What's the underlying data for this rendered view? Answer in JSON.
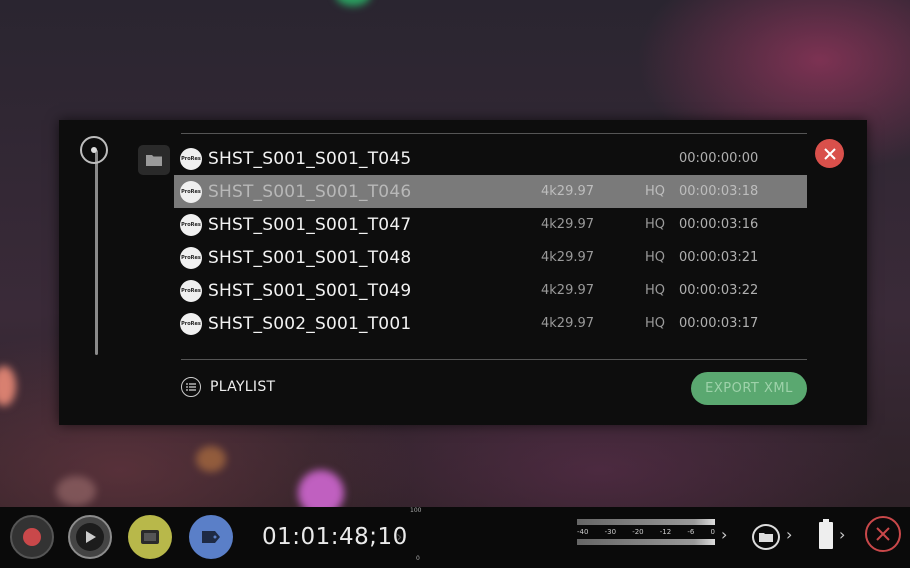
{
  "dialog": {
    "clips": [
      {
        "name": "SHST_S001_S001_T045",
        "resolution": "",
        "codec": "",
        "timecode": "00:00:00:00",
        "selected": false,
        "badge": "ProRes"
      },
      {
        "name": "SHST_S001_S001_T046",
        "resolution": "4k29.97",
        "codec": "HQ",
        "timecode": "00:00:03:18",
        "selected": true,
        "badge": "ProRes"
      },
      {
        "name": "SHST_S001_S001_T047",
        "resolution": "4k29.97",
        "codec": "HQ",
        "timecode": "00:00:03:16",
        "selected": false,
        "badge": "ProRes"
      },
      {
        "name": "SHST_S001_S001_T048",
        "resolution": "4k29.97",
        "codec": "HQ",
        "timecode": "00:00:03:21",
        "selected": false,
        "badge": "ProRes"
      },
      {
        "name": "SHST_S001_S001_T049",
        "resolution": "4k29.97",
        "codec": "HQ",
        "timecode": "00:00:03:22",
        "selected": false,
        "badge": "ProRes"
      },
      {
        "name": "SHST_S002_S001_T001",
        "resolution": "4k29.97",
        "codec": "HQ",
        "timecode": "00:00:03:17",
        "selected": false,
        "badge": "ProRes"
      }
    ],
    "playlist_label": "PLAYLIST",
    "export_label": "EXPORT XML"
  },
  "bottombar": {
    "timecode": "01:01:48;10",
    "vu_top": "100",
    "vu_bottom": "0",
    "meter_scale": [
      "-40",
      "-30",
      "-20",
      "-12",
      "-6",
      "0"
    ]
  },
  "colors": {
    "record": "#c9484a",
    "play_ring": "#8c8c8c",
    "monitor": "#b8b84a",
    "tag": "#5a7fc8",
    "export": "#5aa870",
    "close": "#d9504b"
  },
  "icons": [
    "record-icon",
    "play-icon",
    "monitor-icon",
    "tag-icon",
    "folder-icon",
    "battery-icon",
    "close-icon",
    "playlist-icon"
  ]
}
